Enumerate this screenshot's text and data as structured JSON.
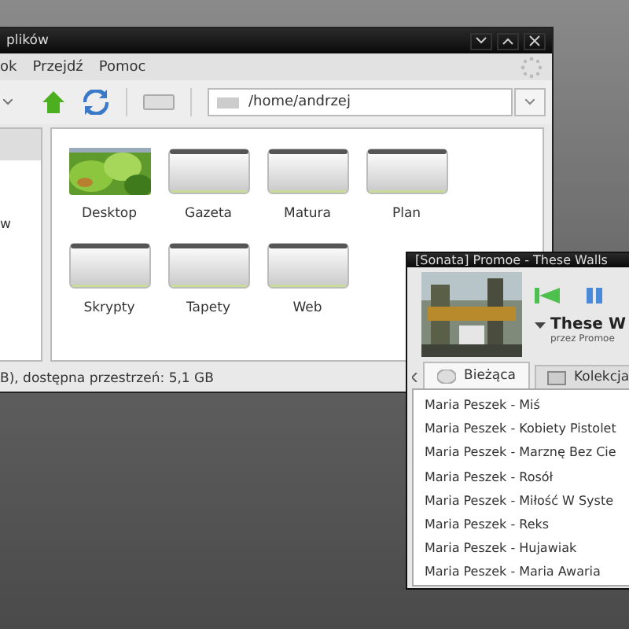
{
  "file_manager": {
    "title": "plików",
    "menu": [
      "ok",
      "Przejdź",
      "Pomoc"
    ],
    "location": "/home/andrzej",
    "sidebar_items": [
      "w"
    ],
    "files": [
      {
        "name": "Desktop",
        "kind": "picture"
      },
      {
        "name": "Gazeta",
        "kind": "folder"
      },
      {
        "name": "Matura",
        "kind": "folder"
      },
      {
        "name": "Plan",
        "kind": "folder"
      },
      {
        "name": "Skrypty",
        "kind": "folder"
      },
      {
        "name": "Tapety",
        "kind": "folder"
      },
      {
        "name": "Web",
        "kind": "folder"
      }
    ],
    "status_bar": "B), dostępna przestrzeń: 5,1 GB"
  },
  "player": {
    "title": "[Sonata] Promoe - These Walls",
    "track": "These W",
    "artist": "przez Promoe",
    "tabs": [
      {
        "label": "Bieżąca",
        "selected": true
      },
      {
        "label": "Kolekcja",
        "selected": false
      }
    ],
    "playlist": [
      "Maria Peszek - Miś",
      "Maria Peszek - Kobiety Pistolet",
      "Maria Peszek - Marznę Bez Cie",
      "Maria Peszek - Rosół",
      "Maria Peszek - Miłość W Syste",
      "Maria Peszek - Reks",
      "Maria Peszek - Hujawiak",
      "Maria Peszek - Maria Awaria"
    ]
  }
}
